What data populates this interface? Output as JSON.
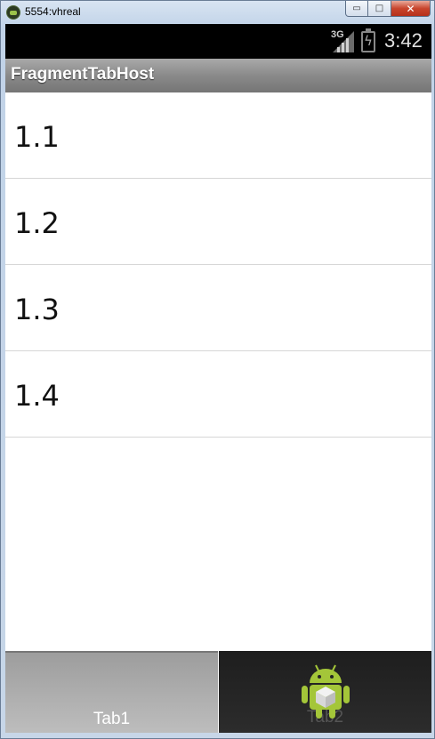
{
  "window": {
    "title": "5554:vhreal",
    "minimize_glyph": "▭",
    "maximize_glyph": "□",
    "close_glyph": "✕"
  },
  "statusbar": {
    "network": "3G",
    "time": "3:42",
    "icons": [
      "signal-icon",
      "battery-charging-icon"
    ]
  },
  "actionbar": {
    "title": "FragmentTabHost"
  },
  "list": {
    "items": [
      "1.1",
      "1.2",
      "1.3",
      "1.4"
    ]
  },
  "tabs": [
    {
      "label": "Tab1",
      "selected": true
    },
    {
      "label": "Tab2",
      "selected": false,
      "icon": "android-icon"
    }
  ],
  "colors": {
    "statusbar_bg": "#000000",
    "actionbar_bg": "#8a8a8a",
    "android_green": "#a4c639",
    "tab_selected_bg": "#b0b0b0",
    "tab_unselected_bg": "#242424"
  }
}
